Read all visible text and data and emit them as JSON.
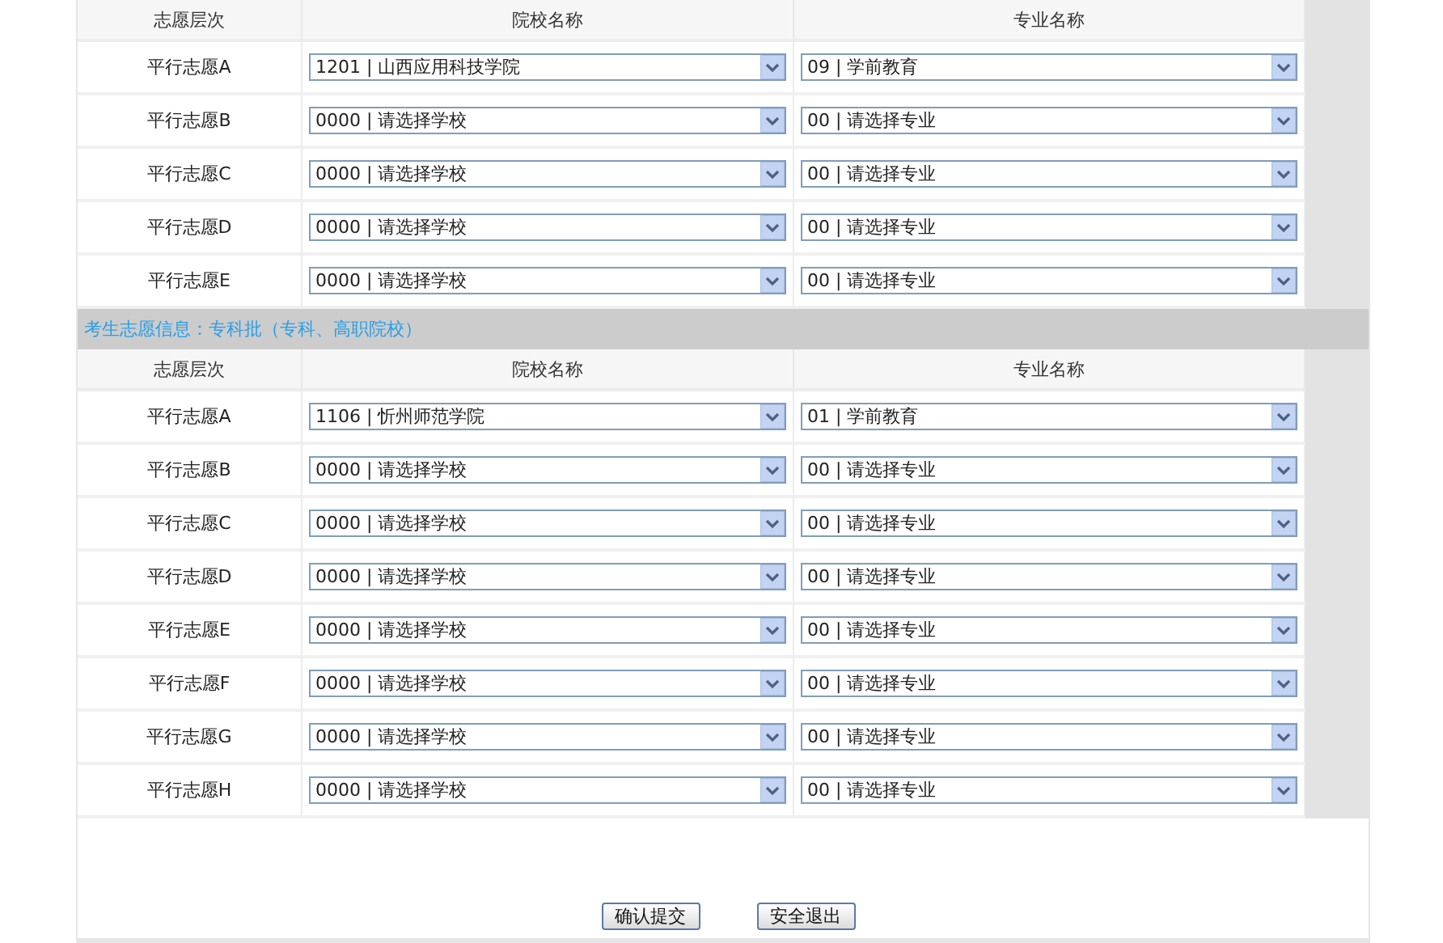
{
  "upper_table": {
    "columns": [
      "志愿层次",
      "院校名称",
      "专业名称"
    ],
    "rows": [
      {
        "tier": "平行志愿A",
        "school": "1201 | 山西应用科技学院",
        "major": "09 | 学前教育"
      },
      {
        "tier": "平行志愿B",
        "school": "0000 | 请选择学校",
        "major": "00 | 请选择专业"
      },
      {
        "tier": "平行志愿C",
        "school": "0000 | 请选择学校",
        "major": "00 | 请选择专业"
      },
      {
        "tier": "平行志愿D",
        "school": "0000 | 请选择学校",
        "major": "00 | 请选择专业"
      },
      {
        "tier": "平行志愿E",
        "school": "0000 | 请选择学校",
        "major": "00 | 请选择专业"
      }
    ]
  },
  "section_title": "考生志愿信息：专科批（专科、高职院校）",
  "lower_table": {
    "columns": [
      "志愿层次",
      "院校名称",
      "专业名称"
    ],
    "rows": [
      {
        "tier": "平行志愿A",
        "school": "1106 | 忻州师范学院",
        "major": "01 | 学前教育"
      },
      {
        "tier": "平行志愿B",
        "school": "0000 | 请选择学校",
        "major": "00 | 请选择专业"
      },
      {
        "tier": "平行志愿C",
        "school": "0000 | 请选择学校",
        "major": "00 | 请选择专业"
      },
      {
        "tier": "平行志愿D",
        "school": "0000 | 请选择学校",
        "major": "00 | 请选择专业"
      },
      {
        "tier": "平行志愿E",
        "school": "0000 | 请选择学校",
        "major": "00 | 请选择专业"
      },
      {
        "tier": "平行志愿F",
        "school": "0000 | 请选择学校",
        "major": "00 | 请选择专业"
      },
      {
        "tier": "平行志愿G",
        "school": "0000 | 请选择学校",
        "major": "00 | 请选择专业"
      },
      {
        "tier": "平行志愿H",
        "school": "0000 | 请选择学校",
        "major": "00 | 请选择专业"
      }
    ]
  },
  "buttons": [
    "确认提交",
    "安全退出"
  ]
}
